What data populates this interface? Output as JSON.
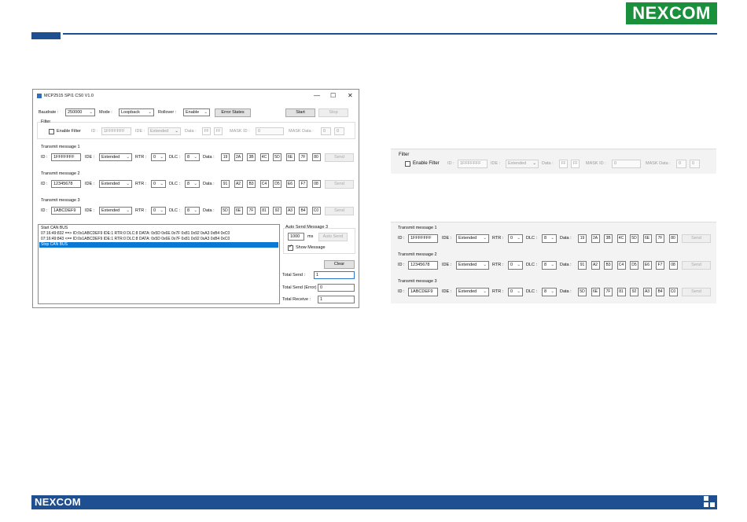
{
  "brand": {
    "logo_text": "NEXCOM",
    "accent": "#1d4f91",
    "logo_green": "#1a8f3c"
  },
  "window": {
    "title": "MCP2515 SPI1 CS0 V1.0",
    "controls": {
      "minimize": "—",
      "maximize": "☐",
      "close": "✕"
    }
  },
  "settings": {
    "baudrate_label": "Baudrate :",
    "baudrate_value": "250000",
    "mode_label": "Mode :",
    "mode_value": "Loopback",
    "rollover_label": "Rollover :",
    "rollover_value": "Enable",
    "error_states_label": "Error States",
    "start_label": "Start",
    "stop_label": "Stop"
  },
  "filter": {
    "title": "Filter",
    "enable_label": "Enable Filter",
    "id_label": "ID :",
    "id_value": "1FFFFFFF",
    "ide_label": "IDE :",
    "ide_value": "Extended",
    "data_label": "Data :",
    "data_values": [
      "FF",
      "FF"
    ],
    "mask_id_label": "MASK ID :",
    "mask_id_value": "0",
    "mask_data_label": "MASK Data :",
    "mask_data_values": [
      "0",
      "0"
    ]
  },
  "labels": {
    "id": "ID :",
    "ide": "IDE :",
    "rtr": "RTR :",
    "dlc": "DLC :",
    "data": "Data :",
    "send": "Send"
  },
  "transmit": [
    {
      "title": "Transmit message 1",
      "id": "1FFFFFFF",
      "ide": "Extended",
      "rtr": "0",
      "dlc": "8",
      "data": [
        "19",
        "2A",
        "3B",
        "4C",
        "5D",
        "6E",
        "7F",
        "80"
      ]
    },
    {
      "title": "Transmit message 2",
      "id": "12345678",
      "ide": "Extended",
      "rtr": "0",
      "dlc": "8",
      "data": [
        "91",
        "A2",
        "B3",
        "C4",
        "D5",
        "E6",
        "F7",
        "08"
      ]
    },
    {
      "title": "Transmit message 3",
      "id": "1ABCDEF9",
      "ide": "Extended",
      "rtr": "0",
      "dlc": "8",
      "data": [
        "5D",
        "6E",
        "7F",
        "81",
        "92",
        "A3",
        "B4",
        "C0"
      ]
    }
  ],
  "log": [
    "Start CAN BUS",
    "07:16:49:832 ==> ID:0x1ABCDEF9 IDE:1 RTR:0 DLC:8 DATA: 0x5D 0x6E 0x7F 0x81 0x92 0xA3 0xB4 0xC0",
    "07:16:49:843 <== ID:0x1ABCDEF9 IDE:1 RTR:0 DLC:8 DATA: 0x5D 0x6E 0x7F 0x81 0x92 0xA3 0xB4 0xC0",
    "Stop CAN BUS"
  ],
  "auto_send": {
    "title": "Auto Send Message 3",
    "interval_value": "1000",
    "unit": "ms",
    "button_label": "Auto Send",
    "show_message_label": "Show Message"
  },
  "counters": {
    "clear_label": "Clear",
    "total_send_label": "Total Send :",
    "total_send_value": "1",
    "total_send_error_label": "Total Send (Error) :",
    "total_send_error_value": "0",
    "total_receive_label": "Total Receive :",
    "total_receive_value": "1"
  }
}
